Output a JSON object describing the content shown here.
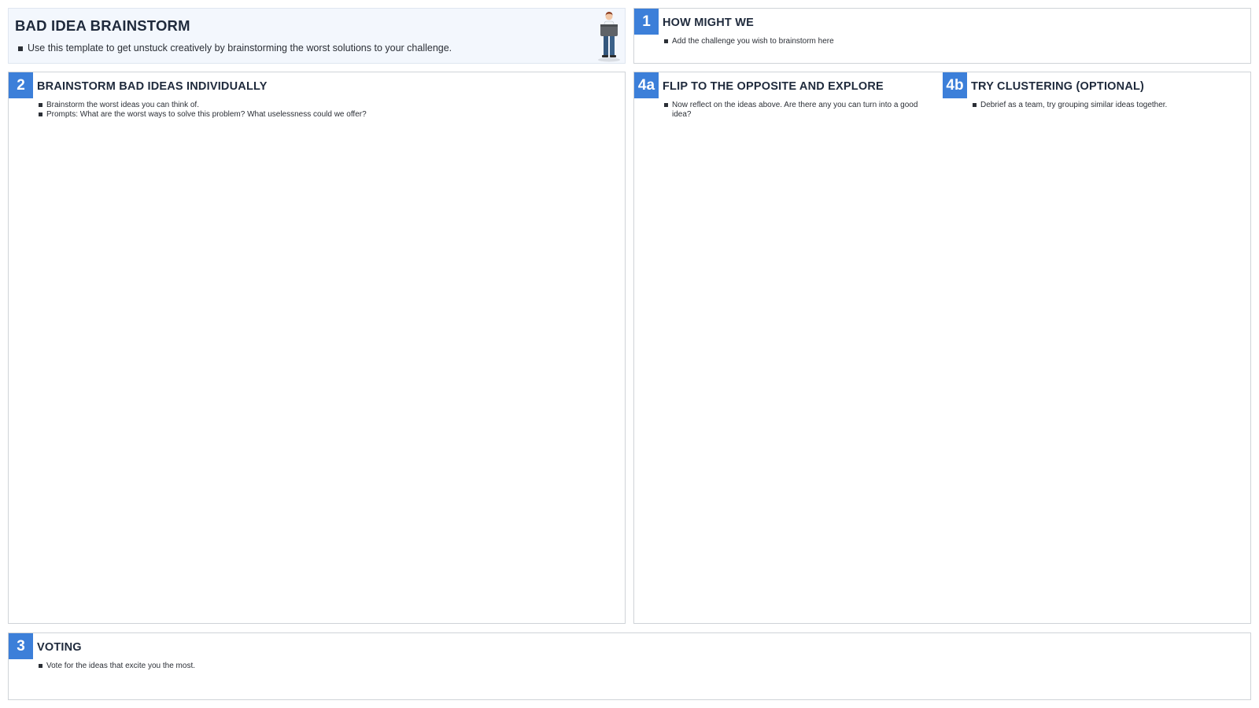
{
  "intro": {
    "title": "BAD IDEA BRAINSTORM",
    "description": "Use this template to get unstuck creatively by brainstorming the worst solutions to your challenge.",
    "illustration": "person-holding-box-illustration"
  },
  "sections": {
    "how_might_we": {
      "number": "1",
      "title": "HOW MIGHT WE",
      "bullets": [
        "Add the challenge you wish to brainstorm here"
      ]
    },
    "brainstorm": {
      "number": "2",
      "title": "BRAINSTORM BAD IDEAS INDIVIDUALLY",
      "bullets": [
        "Brainstorm the worst ideas you can think of.",
        "Prompts: What are the worst ways to solve this problem? What uselessness could we offer?"
      ]
    },
    "flip": {
      "number": "4a",
      "title": "FLIP TO THE OPPOSITE AND EXPLORE",
      "bullets": [
        "Now reflect on the ideas above. Are there any you can turn into a good idea?"
      ]
    },
    "cluster": {
      "number": "4b",
      "title": "TRY CLUSTERING (OPTIONAL)",
      "bullets": [
        "Debrief as a team, try grouping similar ideas together."
      ]
    },
    "voting": {
      "number": "3",
      "title": "VOTING",
      "bullets": [
        "Vote for the ideas that excite you the most."
      ]
    }
  },
  "colors": {
    "accent": "#3c7fd9",
    "intro_background": "#f3f7fd",
    "border": "#cfd3d8",
    "text": "#1f2a3c"
  }
}
